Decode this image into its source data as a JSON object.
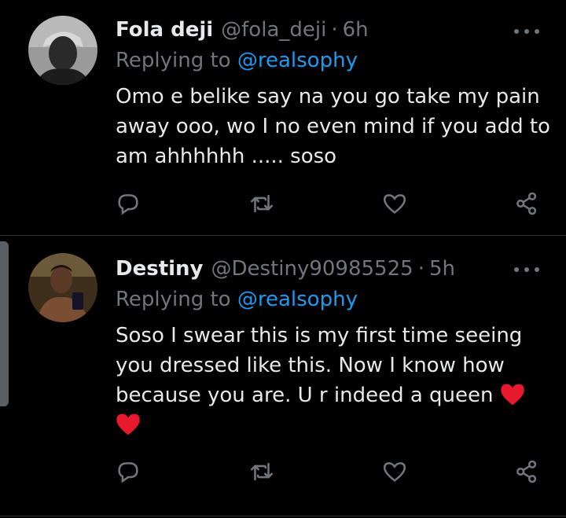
{
  "tweets": [
    {
      "name": "Fola deji",
      "handle": "@fola_deji",
      "separator": "·",
      "time": "6h",
      "reply_prefix": "Replying to",
      "reply_mention": "@realsophy",
      "lines": [
        "Omo e belike say na you go take my pain",
        "away ooo, wo I no even mind if you add to",
        "am ahhhhhh ..... soso"
      ]
    },
    {
      "name": "Destiny",
      "handle": "@Destiny90985525",
      "separator": "·",
      "time": "5h",
      "reply_prefix": "Replying to",
      "reply_mention": "@realsophy",
      "lines": [
        "Soso I swear this is my first time seeing",
        "you dressed like this. Now I know how",
        "because you are. U r indeed a queen"
      ]
    }
  ],
  "icons": {
    "reply": "comment-icon",
    "retweet": "retweet-icon",
    "like": "heart-outline-icon",
    "share": "share-icon",
    "emoji": "red-heart-emoji-icon"
  },
  "colors": {
    "background": "#000000",
    "text": "#e7e9ea",
    "muted": "#71767b",
    "link": "#1d9bf0",
    "emoji_heart": "#e8192c"
  }
}
